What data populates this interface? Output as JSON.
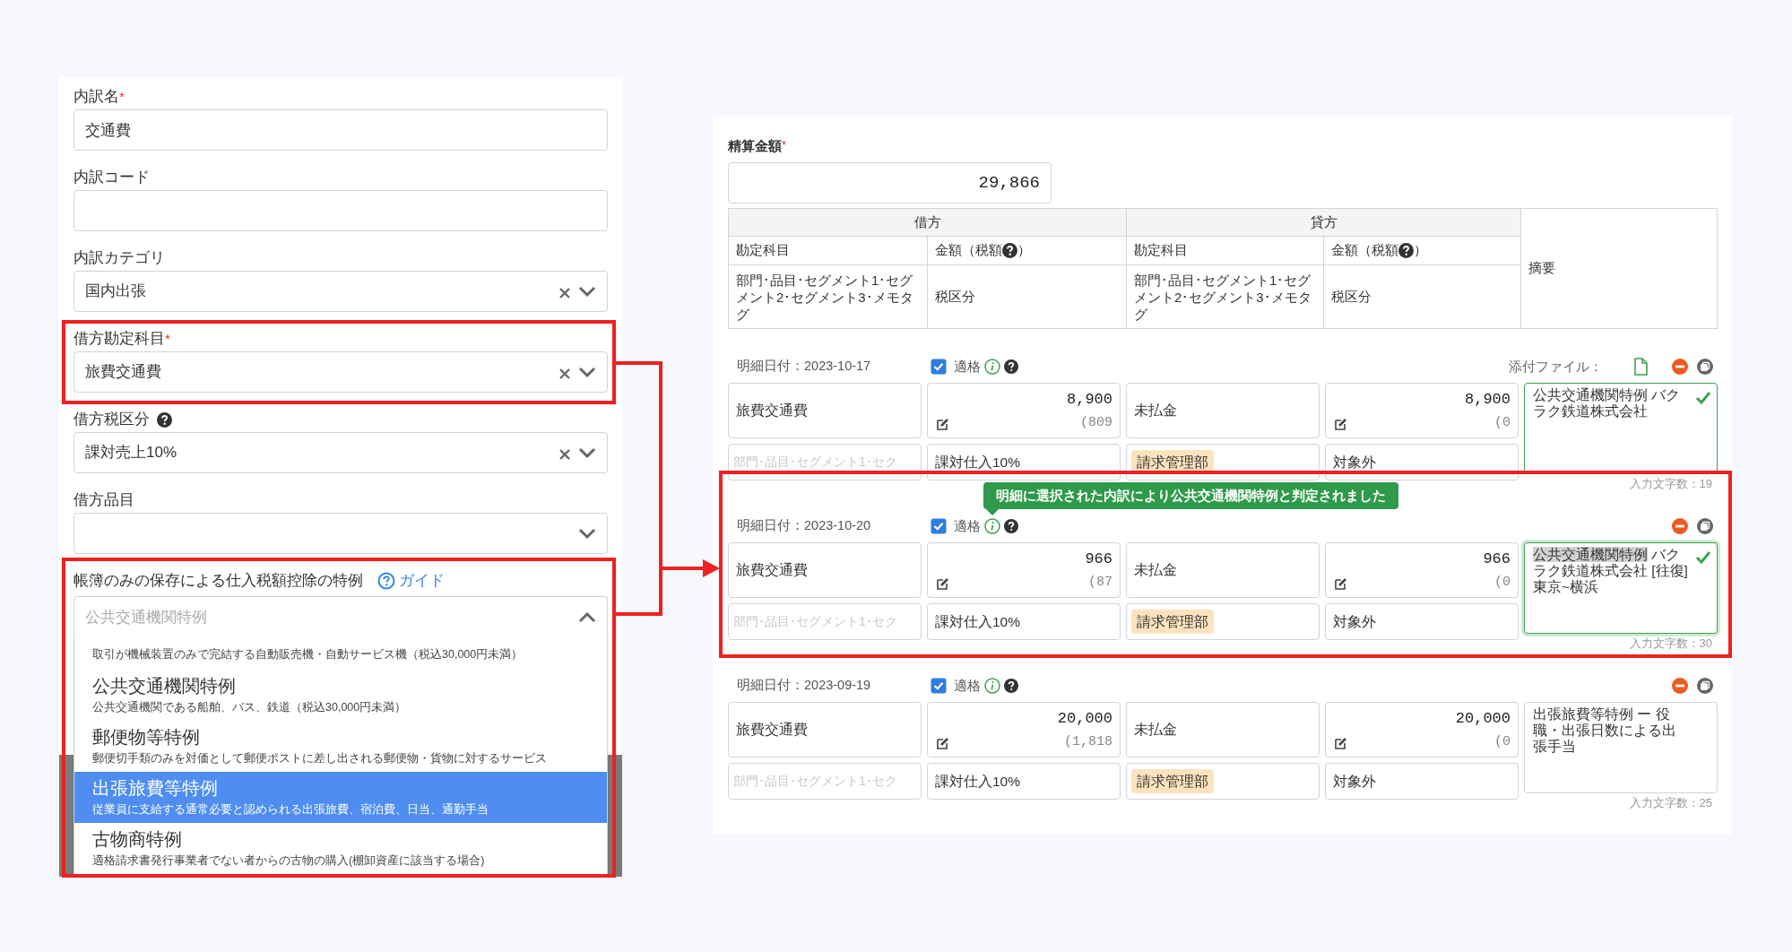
{
  "detail_form": {
    "fields": [
      {
        "kind": "text",
        "label": "内訳名",
        "required_mark": "*",
        "value": "交通費"
      },
      {
        "kind": "text",
        "label": "内訳コード"
      },
      {
        "kind": "select",
        "label": "内訳カテゴリ",
        "value": "国内出張",
        "clearable": true
      },
      {
        "kind": "select",
        "label": "借方勘定科目",
        "required_mark": "*",
        "value": "旅費交通費",
        "clearable": true
      },
      {
        "kind": "select",
        "label": "借方税区分",
        "help": true,
        "value": "課対売上10%",
        "clearable": true
      },
      {
        "kind": "select",
        "label": "借方品目",
        "clearable": false
      }
    ],
    "special_case": {
      "label": "帳簿のみの保存による仕入税額控除の特例",
      "guide_link": "ガイド",
      "placeholder": "公共交通機関特例",
      "expanded": true,
      "options": [
        {
          "description": "取引が機械装置のみで完結する自動販売機・自動サービス機（税込30,000円未満）",
          "selected": false
        },
        {
          "title": "公共交通機関特例",
          "description": "公共交通機関である船舶、バス、鉄道（税込30,000円未満）",
          "selected": false
        },
        {
          "title": "郵便物等特例",
          "description": "郵便切手類のみを対価として郵便ポストに差し出される郵便物・貨物に対するサービス",
          "selected": false
        },
        {
          "title": "出張旅費等特例",
          "description": "従業員に支給する通常必要と認められる出張旅費、宿泊費、日当、通勤手当",
          "selected": true
        },
        {
          "title": "古物商特例",
          "description": "適格請求書発行事業者でない者からの古物の購入(棚卸資産に該当する場合)",
          "selected": false
        }
      ]
    }
  },
  "journal": {
    "settlement_label": "精算金額",
    "settlement_required_mark": "*",
    "settlement_amount": "29,866",
    "header": {
      "debit": "借方",
      "credit": "貸方",
      "memo": "摘要",
      "sides": [
        {
          "account": "勘定科目",
          "amount": "金額（税額",
          "amount_close": "）",
          "dimensions": "部門･品目･セグメント1･セグメント2･セグメント3･メモタグ",
          "tax_class": "税区分"
        },
        {
          "account": "勘定科目",
          "amount": "金額（税額",
          "amount_close": "）",
          "dimensions": "部門･品目･セグメント1･セグメント2･セグメント3･メモタグ",
          "tax_class": "税区分"
        }
      ]
    },
    "lines": [
      {
        "date": "明細日付：2023-10-17",
        "qualified": true,
        "qualified_label": "適格",
        "attachment_label": "添付ファイル：",
        "debit": {
          "account": "旅費交通費",
          "amount": "8,900",
          "tax": "(809"
        },
        "credit": {
          "account": "未払金",
          "amount": "8,900",
          "tax": "(0"
        },
        "dimensions_placeholder": "部門･品目･セグメント1･セク",
        "debit_tax_class": "課対仕入10%",
        "department": "請求管理部",
        "credit_tax_class": "対象外",
        "memo": "公共交通機関特例 バクラク鉄道株式会社",
        "memo_valid": true,
        "memo_focused": false,
        "char_count": "入力文字数：19"
      },
      {
        "date": "明細日付：2023-10-20",
        "qualified": true,
        "qualified_label": "適格",
        "tooltip": "明細に選択された内訳により公共交通機関特例と判定されました",
        "debit": {
          "account": "旅費交通費",
          "amount": "966",
          "tax": "(87"
        },
        "credit": {
          "account": "未払金",
          "amount": "966",
          "tax": "(0"
        },
        "dimensions_placeholder": "部門･品目･セグメント1･セク",
        "debit_tax_class": "課対仕入10%",
        "department": "請求管理部",
        "credit_tax_class": "対象外",
        "memo_selected": "公共交通機関特例",
        "memo": " バクラク鉄道株式会社  [往復]東京~横浜",
        "memo_valid": true,
        "memo_focused": true,
        "char_count": "入力文字数：30"
      },
      {
        "date": "明細日付：2023-09-19",
        "qualified": true,
        "qualified_label": "適格",
        "debit": {
          "account": "旅費交通費",
          "amount": "20,000",
          "tax": "(1,818"
        },
        "credit": {
          "account": "未払金",
          "amount": "20,000",
          "tax": "(0"
        },
        "dimensions_placeholder": "部門･品目･セグメント1･セク",
        "debit_tax_class": "課対仕入10%",
        "department": "請求管理部",
        "credit_tax_class": "対象外",
        "memo": "出張旅費等特例 ー 役職・出張日数による出張手当",
        "memo_valid": false,
        "memo_focused": false,
        "char_count": "入力文字数：25"
      }
    ]
  }
}
